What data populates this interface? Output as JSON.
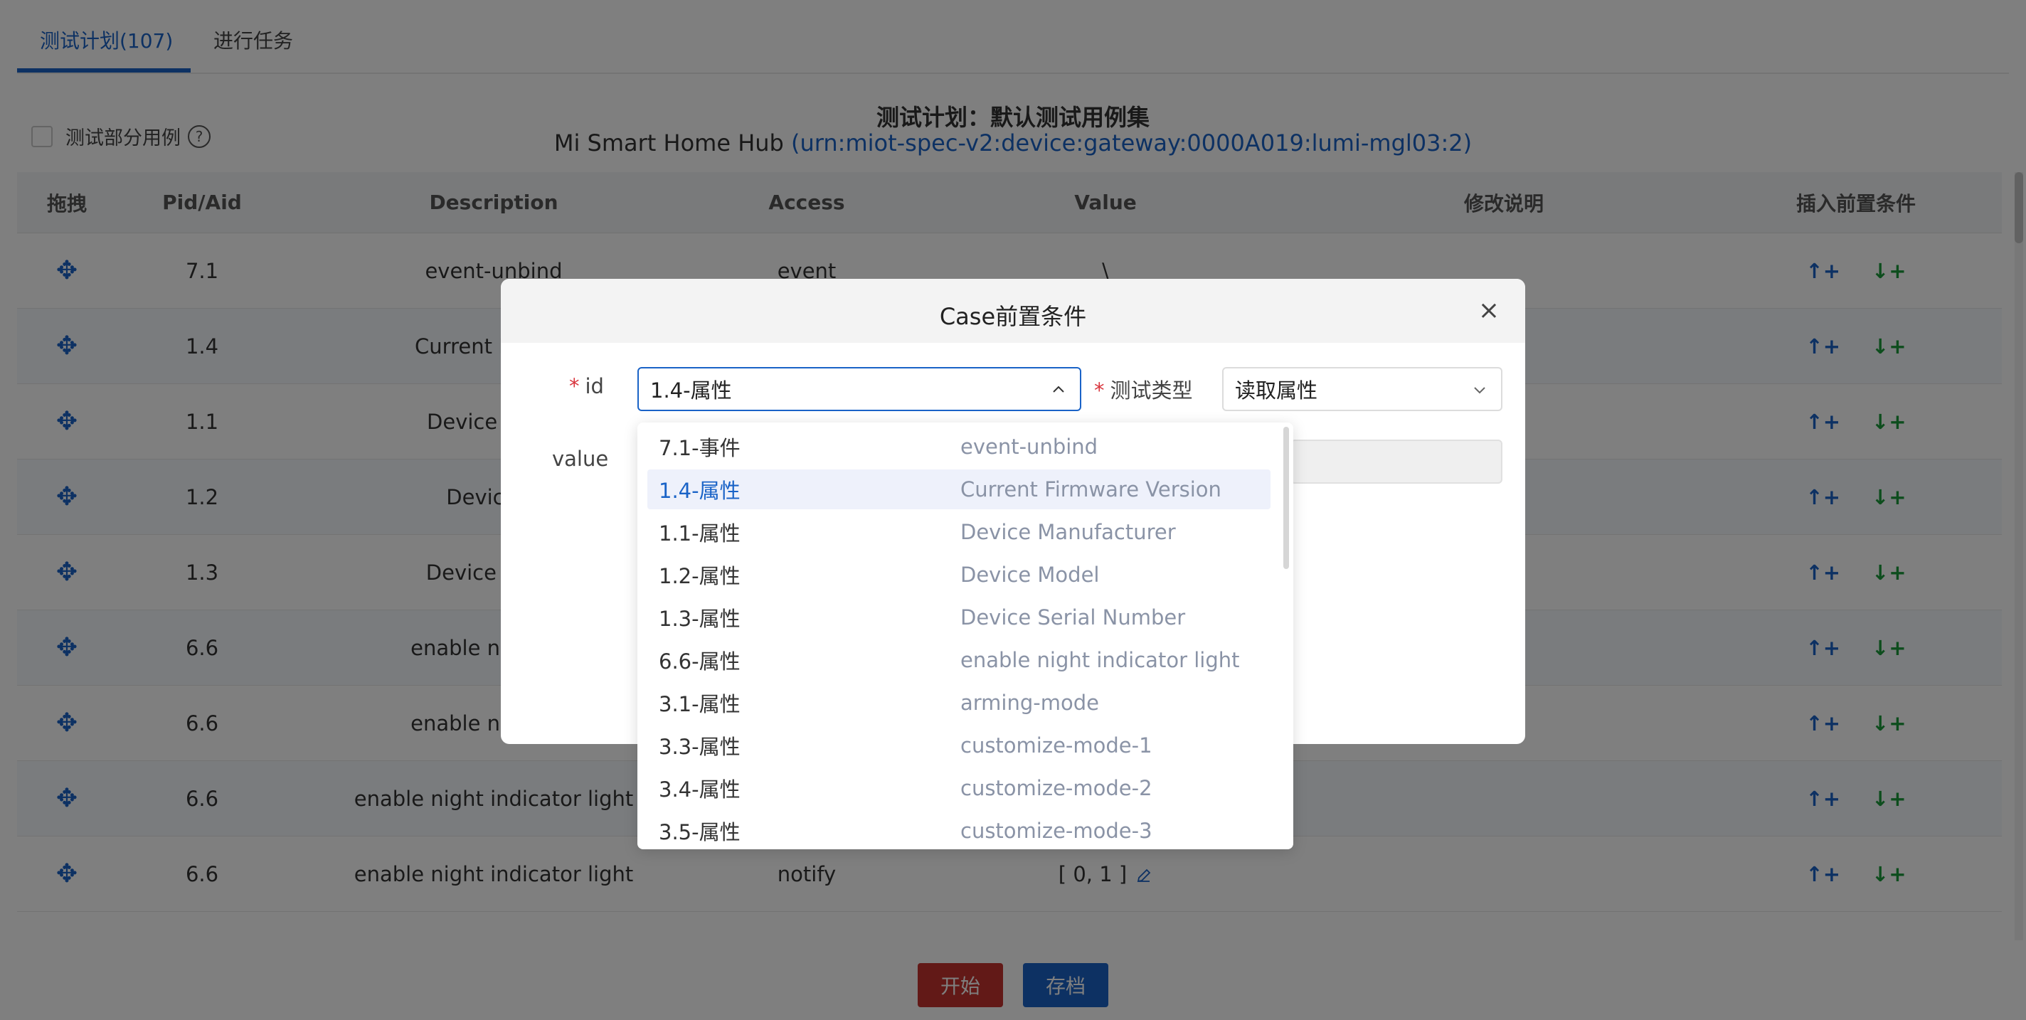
{
  "tabs": [
    {
      "label": "测试计划(107)"
    },
    {
      "label": "进行任务"
    }
  ],
  "plan": {
    "title": "测试计划：默认测试用例集",
    "device_name": "Mi Smart Home Hub",
    "urn": "(urn:miot-spec-v2:device:gateway:0000A019:lumi-mgl03:2)"
  },
  "partial_checkbox_label": "测试部分用例",
  "help_icon": "?",
  "table": {
    "headers": [
      "拖拽",
      "Pid/Aid",
      "Description",
      "Access",
      "Value",
      "修改说明",
      "插入前置条件"
    ],
    "rows": [
      {
        "pid": "7.1",
        "desc": "event-unbind",
        "access": "event",
        "value": "\\"
      },
      {
        "pid": "1.4",
        "desc": "Current Firmwa",
        "access": "",
        "value": ""
      },
      {
        "pid": "1.1",
        "desc": "Device Manu",
        "access": "",
        "value": ""
      },
      {
        "pid": "1.2",
        "desc": "Device M",
        "access": "",
        "value": ""
      },
      {
        "pid": "1.3",
        "desc": "Device Serial",
        "access": "",
        "value": ""
      },
      {
        "pid": "6.6",
        "desc": "enable night inc",
        "access": "",
        "value": ""
      },
      {
        "pid": "6.6",
        "desc": "enable night inc",
        "access": "",
        "value": ""
      },
      {
        "pid": "6.6",
        "desc": "enable night indicator light",
        "access": "",
        "value": ""
      },
      {
        "pid": "6.6",
        "desc": "enable night indicator light",
        "access": "notify",
        "value": "[ 0, 1 ]"
      }
    ],
    "insert_up": "↑+",
    "insert_down": "↓+",
    "drag_glyph": "✥"
  },
  "buttons": {
    "start": "开始",
    "save": "存档"
  },
  "modal": {
    "title": "Case前置条件",
    "close": "×",
    "id_label": "id",
    "id_value": "1.4-属性",
    "type_label": "测试类型",
    "type_value": "读取属性",
    "value_label": "value",
    "required_mark": "*"
  },
  "dropdown": {
    "items": [
      {
        "key": "7.1-事件",
        "desc": "event-unbind",
        "selected": false
      },
      {
        "key": "1.4-属性",
        "desc": "Current Firmware Version",
        "selected": true
      },
      {
        "key": "1.1-属性",
        "desc": "Device Manufacturer",
        "selected": false
      },
      {
        "key": "1.2-属性",
        "desc": "Device Model",
        "selected": false
      },
      {
        "key": "1.3-属性",
        "desc": "Device Serial Number",
        "selected": false
      },
      {
        "key": "6.6-属性",
        "desc": "enable night indicator light",
        "selected": false
      },
      {
        "key": "3.1-属性",
        "desc": "arming-mode",
        "selected": false
      },
      {
        "key": "3.3-属性",
        "desc": "customize-mode-1",
        "selected": false
      },
      {
        "key": "3.4-属性",
        "desc": "customize-mode-2",
        "selected": false
      },
      {
        "key": "3.5-属性",
        "desc": "customize-mode-3",
        "selected": false
      }
    ]
  },
  "colors": {
    "accent": "#1a63c7",
    "danger": "#c4332e",
    "success": "#1b9a3a",
    "required": "#d9363e"
  }
}
